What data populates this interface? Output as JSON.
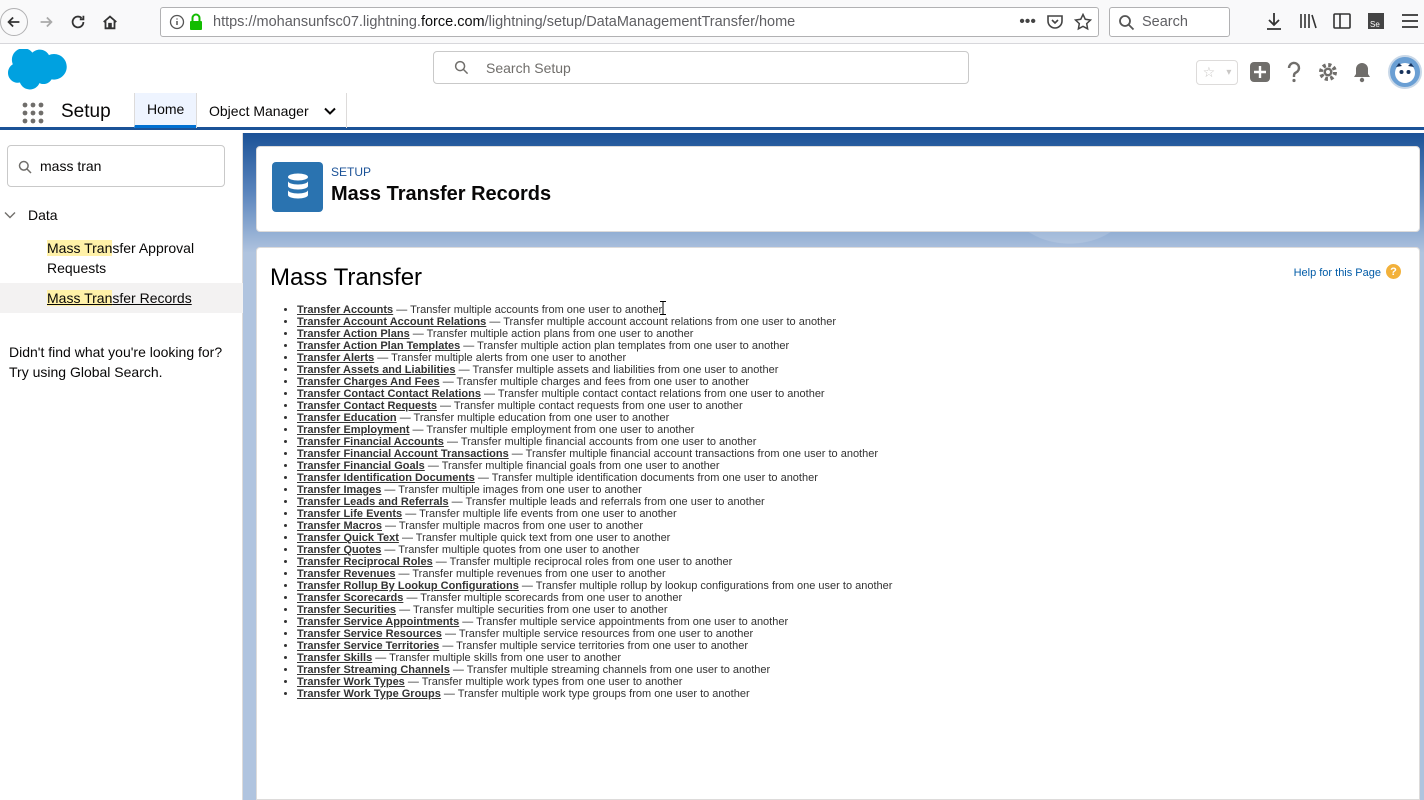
{
  "browser": {
    "url_prefix": "https://mohansunfsc07.lightning.",
    "url_domain": "force.com",
    "url_suffix": "/lightning/setup/DataManagementTransfer/home",
    "url_more": "•••",
    "search_placeholder": "Search"
  },
  "header": {
    "search_placeholder": "Search Setup"
  },
  "nav": {
    "app_name": "Setup",
    "tabs": [
      {
        "label": "Home"
      },
      {
        "label": "Object Manager"
      }
    ]
  },
  "sidebar": {
    "quickfind_value": "mass tran",
    "section": "Data",
    "items": [
      {
        "hl": "Mass Tran",
        "rest": "sfer Approval Requests"
      },
      {
        "hl": "Mass Tran",
        "rest": "sfer Records"
      }
    ],
    "not_found_line1": "Didn't find what you're looking for?",
    "not_found_line2": "Try using Global Search."
  },
  "page_header": {
    "eyebrow": "SETUP",
    "title": "Mass Transfer Records"
  },
  "content": {
    "title": "Mass Transfer",
    "help_link": "Help for this Page",
    "help_icon": "?",
    "items": [
      {
        "link": "Transfer Accounts",
        "desc": " — Transfer multiple accounts from one user to another"
      },
      {
        "link": "Transfer Account Account Relations",
        "desc": " — Transfer multiple account account relations from one user to another"
      },
      {
        "link": "Transfer Action Plans",
        "desc": " — Transfer multiple action plans from one user to another"
      },
      {
        "link": "Transfer Action Plan Templates",
        "desc": " — Transfer multiple action plan templates from one user to another"
      },
      {
        "link": "Transfer Alerts",
        "desc": " — Transfer multiple alerts from one user to another"
      },
      {
        "link": "Transfer Assets and Liabilities",
        "desc": " — Transfer multiple assets and liabilities from one user to another"
      },
      {
        "link": "Transfer Charges And Fees",
        "desc": " — Transfer multiple charges and fees from one user to another"
      },
      {
        "link": "Transfer Contact Contact Relations",
        "desc": " — Transfer multiple contact contact relations from one user to another"
      },
      {
        "link": "Transfer Contact Requests",
        "desc": " — Transfer multiple contact requests from one user to another"
      },
      {
        "link": "Transfer Education",
        "desc": " — Transfer multiple education from one user to another"
      },
      {
        "link": "Transfer Employment",
        "desc": " — Transfer multiple employment from one user to another"
      },
      {
        "link": "Transfer Financial Accounts",
        "desc": " — Transfer multiple financial accounts from one user to another"
      },
      {
        "link": "Transfer Financial Account Transactions",
        "desc": " — Transfer multiple financial account transactions from one user to another"
      },
      {
        "link": "Transfer Financial Goals",
        "desc": " — Transfer multiple financial goals from one user to another"
      },
      {
        "link": "Transfer Identification Documents",
        "desc": " — Transfer multiple identification documents from one user to another"
      },
      {
        "link": "Transfer Images",
        "desc": " — Transfer multiple images from one user to another"
      },
      {
        "link": "Transfer Leads and Referrals",
        "desc": " — Transfer multiple leads and referrals from one user to another"
      },
      {
        "link": "Transfer Life Events",
        "desc": " — Transfer multiple life events from one user to another"
      },
      {
        "link": "Transfer Macros",
        "desc": " — Transfer multiple macros from one user to another"
      },
      {
        "link": "Transfer Quick Text",
        "desc": " — Transfer multiple quick text from one user to another"
      },
      {
        "link": "Transfer Quotes",
        "desc": " — Transfer multiple quotes from one user to another"
      },
      {
        "link": "Transfer Reciprocal Roles",
        "desc": " — Transfer multiple reciprocal roles from one user to another"
      },
      {
        "link": "Transfer Revenues",
        "desc": " — Transfer multiple revenues from one user to another"
      },
      {
        "link": "Transfer Rollup By Lookup Configurations",
        "desc": " — Transfer multiple rollup by lookup configurations from one user to another"
      },
      {
        "link": "Transfer Scorecards",
        "desc": " — Transfer multiple scorecards from one user to another"
      },
      {
        "link": "Transfer Securities",
        "desc": " — Transfer multiple securities from one user to another"
      },
      {
        "link": "Transfer Service Appointments",
        "desc": " — Transfer multiple service appointments from one user to another"
      },
      {
        "link": "Transfer Service Resources",
        "desc": " — Transfer multiple service resources from one user to another"
      },
      {
        "link": "Transfer Service Territories",
        "desc": " — Transfer multiple service territories from one user to another"
      },
      {
        "link": "Transfer Skills",
        "desc": " — Transfer multiple skills from one user to another"
      },
      {
        "link": "Transfer Streaming Channels",
        "desc": " — Transfer multiple streaming channels from one user to another"
      },
      {
        "link": "Transfer Work Types",
        "desc": " — Transfer multiple work types from one user to another"
      },
      {
        "link": "Transfer Work Type Groups",
        "desc": " — Transfer multiple work type groups from one user to another"
      }
    ]
  },
  "colors": {
    "brand": "#1b5297",
    "link": "#015ba7",
    "highlight": "#fff1a8",
    "help": "#f2b13b"
  }
}
